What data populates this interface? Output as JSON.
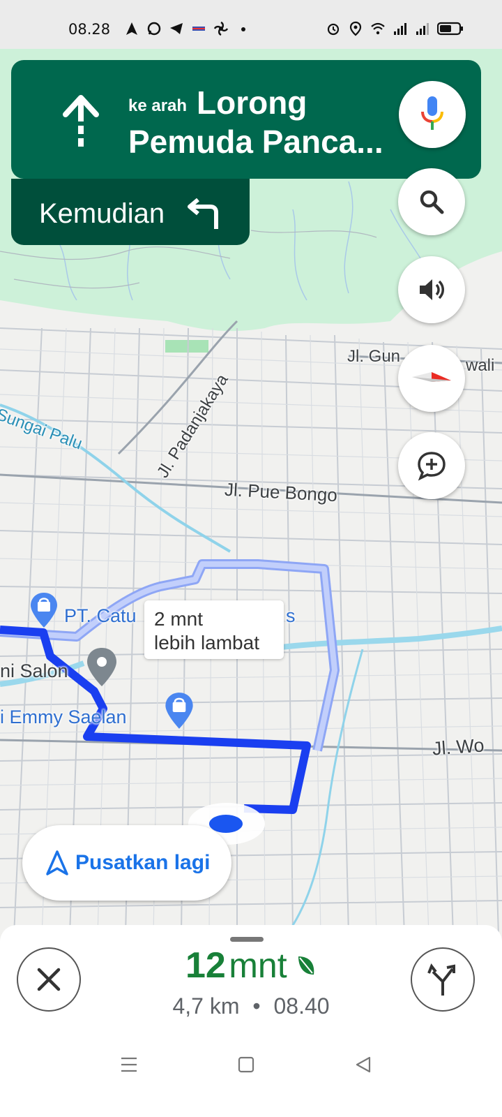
{
  "status_bar": {
    "time": "08.28",
    "left_icons": [
      "navigation-icon",
      "whatsapp-icon",
      "telegram-icon",
      "app-icon",
      "pinwheel-icon",
      "dot-icon"
    ],
    "right_icons": [
      "alarm-icon",
      "location-icon",
      "wifi-icon",
      "signal-icon",
      "signal-icon",
      "battery-icon"
    ]
  },
  "navigation": {
    "toward_prefix": "ke arah",
    "street_line1": "Lorong",
    "street_line2": "Pemuda Panca...",
    "then_label": "Kemudian",
    "then_icon": "turn-left-icon"
  },
  "map": {
    "labels": {
      "padanjakaya": "Jl. Padanjakaya",
      "sungai_palu": "Sungai Palu",
      "gunung": "Jl. Gun",
      "wali": "wali",
      "pue_bongo": "Jl. Pue Bongo",
      "pt_catu": "PT. Catu",
      "catu_suffix": "s",
      "salon": "ni Salon",
      "emmy": "i Emmy Saelan",
      "wo": "Jl. Wo"
    },
    "alt_route_bubble": {
      "line1": "2 mnt",
      "line2": "lebih lambat"
    },
    "recenter_label": "Pusatkan lagi"
  },
  "trip": {
    "minutes": "12",
    "unit": "mnt",
    "distance": "4,7 km",
    "separator": "•",
    "arrival": "08.40"
  },
  "colors": {
    "nav_green": "#00684e",
    "nav_dark_green": "#004f3b",
    "route_blue": "#1a3ff0",
    "eta_green": "#188038"
  }
}
